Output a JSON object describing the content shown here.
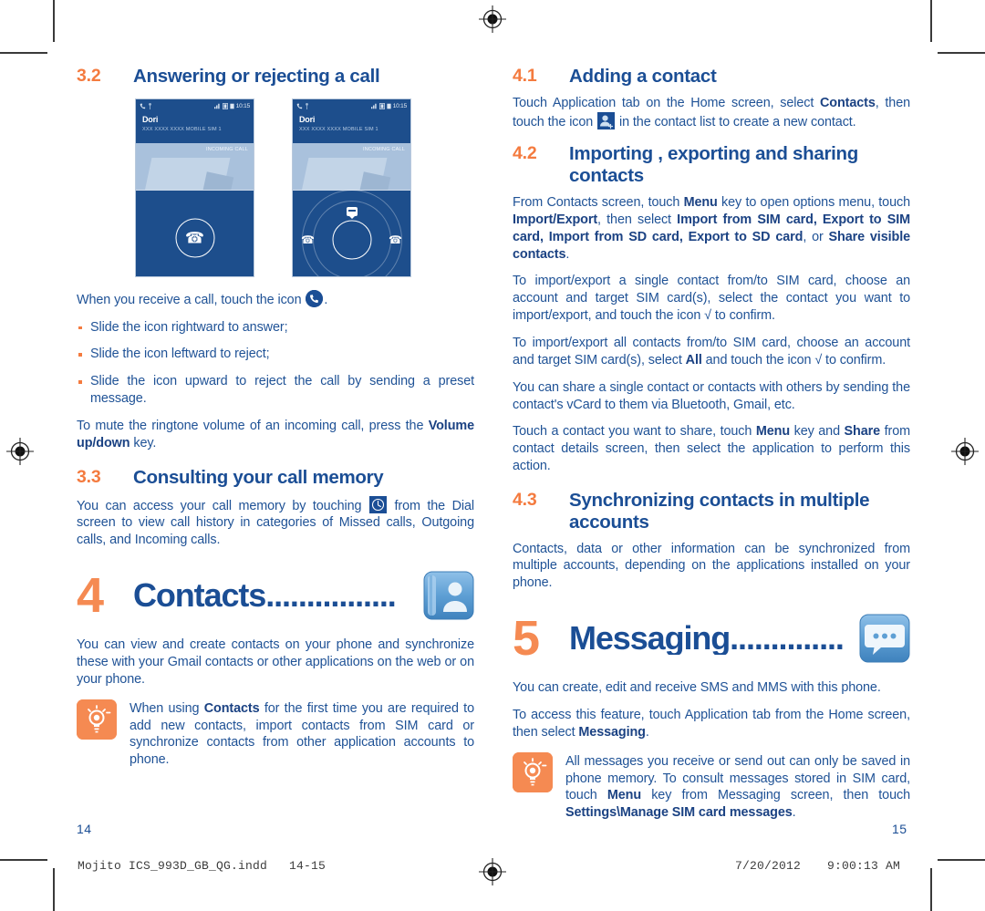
{
  "document": {
    "left_page_number": "14",
    "right_page_number": "15",
    "footer_filename": "Mojito ICS_993D_GB_QG.indd   14-15",
    "footer_date": "7/20/2012",
    "footer_time": "9:00:13 AM",
    "accent_orange": "#f47b3f",
    "accent_blue": "#1b4e95"
  },
  "left_page": {
    "section_32": {
      "number": "3.2",
      "title": "Answering or rejecting a call",
      "phones": [
        {
          "status_time": "10:15",
          "contact_name": "Dori",
          "contact_sub": "XXX XXXX XXXX  MOBILE  SIM 1",
          "call_state": "INCOMING CALL"
        },
        {
          "status_time": "10:15",
          "contact_name": "Dori",
          "contact_sub": "XXX XXXX XXXX  MOBILE  SIM 1",
          "call_state": "INCOMING CALL"
        }
      ],
      "intro_before_icon": "When you receive a call, touch the icon ",
      "intro_after_icon": ".",
      "bullets": [
        "Slide the icon rightward to answer;",
        "Slide the icon leftward to reject;",
        "Slide the icon upward to reject the call by sending a preset message."
      ],
      "mute_text_1": "To mute the ringtone volume of an incoming call, press the ",
      "mute_bold": "Volume up/down",
      "mute_text_2": " key."
    },
    "section_33": {
      "number": "3.3",
      "title": "Consulting your call memory",
      "body_1": "You can access your call memory by touching ",
      "body_2": " from the Dial screen to view call history in categories of Missed calls, Outgoing calls, and Incoming calls."
    },
    "chapter_4": {
      "number": "4",
      "title": "Contacts................",
      "icon": "contacts-app-icon",
      "body": "You can view and create contacts on your phone and synchronize these with your Gmail contacts or other applications on the web or on your phone.",
      "tip_1": "When using ",
      "tip_bold": "Contacts",
      "tip_2": " for the first time you are required to add new contacts, import contacts from SIM card or synchronize contacts from other application accounts to phone."
    }
  },
  "right_page": {
    "section_41": {
      "number": "4.1",
      "title": "Adding a contact",
      "body_1": "Touch Application tab on the Home screen, select ",
      "body_bold": "Contacts",
      "body_2": ", then touch the icon ",
      "body_3": " in the contact list to create a new contact."
    },
    "section_42": {
      "number": "4.2",
      "title": "Importing , exporting and sharing contacts",
      "para_1_a": "From Contacts screen, touch ",
      "para_1_menu": "Menu",
      "para_1_b": " key to open options menu, touch ",
      "para_1_ie": "Import/Export",
      "para_1_c": ", then select ",
      "para_1_opts": "Import from SIM card, Export to SIM card, Import from SD card, Export to SD card",
      "para_1_d": ", or ",
      "para_1_share": "Share visible contacts",
      "para_1_e": ".",
      "para_2": "To import/export a single contact from/to SIM card, choose an account and target SIM card(s), select the contact you want to import/export, and touch the icon √ to confirm.",
      "para_3_a": "To import/export all contacts from/to SIM card, choose an account and target SIM card(s), select ",
      "para_3_all": "All",
      "para_3_b": " and touch the icon √ to confirm.",
      "para_4": "You can share a single contact or contacts with others by sending the contact's vCard to them via Bluetooth, Gmail, etc.",
      "para_5_a": "Touch a contact you want to share, touch ",
      "para_5_menu": "Menu",
      "para_5_b": " key and ",
      "para_5_share": "Share",
      "para_5_c": " from contact details screen, then select the application to perform this action."
    },
    "section_43": {
      "number": "4.3",
      "title": "Synchronizing contacts in multiple accounts",
      "body": "Contacts, data or other information can be synchronized from multiple accounts, depending on the applications installed on your phone."
    },
    "chapter_5": {
      "number": "5",
      "title": "Messaging..............",
      "icon": "messaging-app-icon",
      "body_1": "You can create, edit and receive SMS and MMS with this phone.",
      "body_2_a": "To access this feature, touch Application tab from the Home screen, then select ",
      "body_2_bold": "Messaging",
      "body_2_b": ".",
      "tip_a": "All messages you receive or send out can only be saved in phone memory. To consult messages stored in SIM card, touch ",
      "tip_menu": "Menu",
      "tip_b": " key from Messaging screen, then touch ",
      "tip_settings": "Settings\\Manage SIM card messages",
      "tip_c": "."
    }
  }
}
